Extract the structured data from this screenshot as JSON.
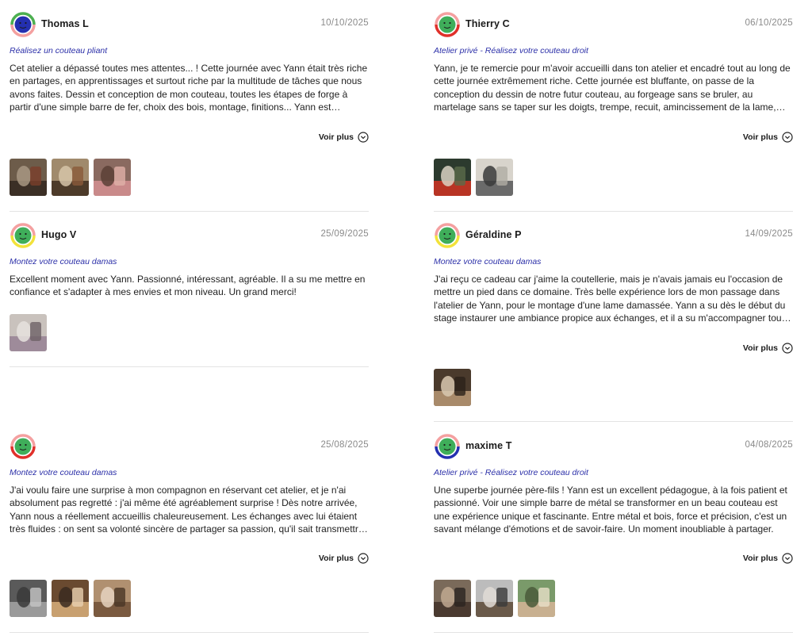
{
  "voir_plus_label": "Voir plus",
  "reviews": [
    {
      "name": "Thomas L",
      "date": "10/10/2025",
      "product": "Réalisez un couteau pliant",
      "text": "Cet atelier a dépassé toutes mes attentes... ! Cette journée avec Yann était très riche en partages, en apprentissages et surtout riche par la multitude de tâches que nous avons faites. Dessin et conception de mon couteau, toutes les étapes de forge à partir d'une simple barre de fer, choix des bois, montage, finitions... Yann est passionné et sait transmettre son savoir.",
      "has_more": true,
      "avatar": {
        "face": "#2430b0",
        "ring_top": "#4caf50",
        "ring_bottom": "#f4a0a0"
      },
      "photos": [
        "photo-apron-workshop",
        "photo-hands-working",
        "photo-pink-apron"
      ]
    },
    {
      "name": "Thierry C",
      "date": "06/10/2025",
      "product": "Atelier privé - Réalisez votre couteau droit",
      "text": "Yann, je te remercie pour m'avoir accueilli dans ton atelier et encadré tout au long de cette journée extrêmement riche. Cette journée est bluffante, on passe de la conception du dessin de notre futur couteau, au forgeage sans se bruler, au martelage sans se taper sur les doigts, trempe, recuit, amincissement de la lame, montage du manche et affûtage.",
      "has_more": true,
      "avatar": {
        "face": "#3fae5a",
        "ring_top": "#f4a0a0",
        "ring_bottom": "#e0302a"
      },
      "photos": [
        "photo-knife-fruit",
        "photo-knife-table"
      ]
    },
    {
      "name": "Hugo V",
      "date": "25/09/2025",
      "product": "Montez votre couteau damas",
      "text": "Excellent moment avec Yann. Passionné, intéressant, agréable. Il a su me mettre en confiance et s'adapter à mes envies et mon niveau. Un grand merci!",
      "has_more": false,
      "avatar": {
        "face": "#3fae5a",
        "ring_top": "#f4a0a0",
        "ring_bottom": "#f2e23a"
      },
      "photos": [
        "photo-damas-blade"
      ]
    },
    {
      "name": "Géraldine P",
      "date": "14/09/2025",
      "product": "Montez votre couteau damas",
      "text": "J'ai reçu ce cadeau car j'aime la coutellerie, mais je n'avais jamais eu l'occasion de mettre un pied dans ce domaine. Très belle expérience lors de mon passage dans l'atelier de Yann, pour le montage d'une lame damassée. Yann a su dès le début du stage instaurer une ambiance propice aux échanges, et il a su m'accompagner tout au long de la journée.",
      "has_more": true,
      "avatar": {
        "face": "#3fae5a",
        "ring_top": "#f4a0a0",
        "ring_bottom": "#f2e23a"
      },
      "photos": [
        "photo-workbench"
      ]
    },
    {
      "name": "",
      "date": "25/08/2025",
      "product": "Montez votre couteau damas",
      "text": "J'ai voulu faire une surprise à mon compagnon en réservant cet atelier, et je n'ai absolument pas regretté : j'ai même été agréablement surprise ! Dès notre arrivée, Yann nous a réellement accueillis chaleureusement. Les échanges avec lui étaient très fluides : on sent sa volonté sincère de partager sa passion, qu'il sait transmettre avec beaucoup de patience.",
      "has_more": true,
      "avatar": {
        "face": "#3fae5a",
        "ring_top": "#f4a0a0",
        "ring_bottom": "#e0302a"
      },
      "photos": [
        "photo-knife-box",
        "photo-man-sanding",
        "photo-hands-knife"
      ]
    },
    {
      "name": "maxime T",
      "date": "04/08/2025",
      "product": "Atelier privé - Réalisez votre couteau droit",
      "text": "Une superbe journée père-fils ! Yann est un excellent pédagogue, à la fois patient et passionné. Voir une simple barre de métal se transformer en un beau couteau est une expérience unique et fascinante. Entre métal et bois, force et précision, c'est un savant mélange d'émotions et de savoir-faire. Un moment inoubliable à partager.",
      "has_more": true,
      "avatar": {
        "face": "#3fae5a",
        "ring_top": "#f4a0a0",
        "ring_bottom": "#2430b0"
      },
      "photos": [
        "photo-forge-man",
        "photo-grinder",
        "photo-outdoor-man"
      ]
    }
  ]
}
